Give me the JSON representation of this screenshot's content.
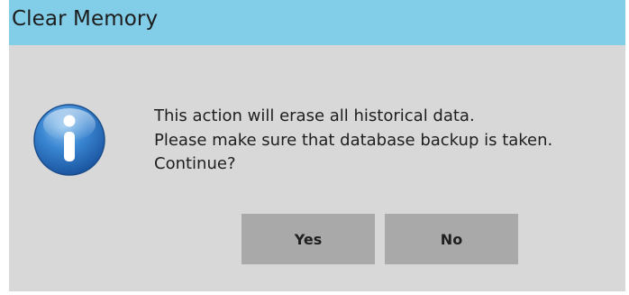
{
  "window": {
    "title": "Clear Memory"
  },
  "dialog": {
    "icon": "info-icon",
    "message_lines": [
      "This action will erase all historical data.",
      "Please make sure that database backup is taken.",
      "Continue?"
    ],
    "buttons": {
      "yes_label": "Yes",
      "no_label": "No"
    }
  },
  "colors": {
    "titlebar": "#82cde8",
    "dialog_background": "#d8d8d8",
    "button_background": "#a9a9a9",
    "icon_blue": "#2b73c4"
  }
}
